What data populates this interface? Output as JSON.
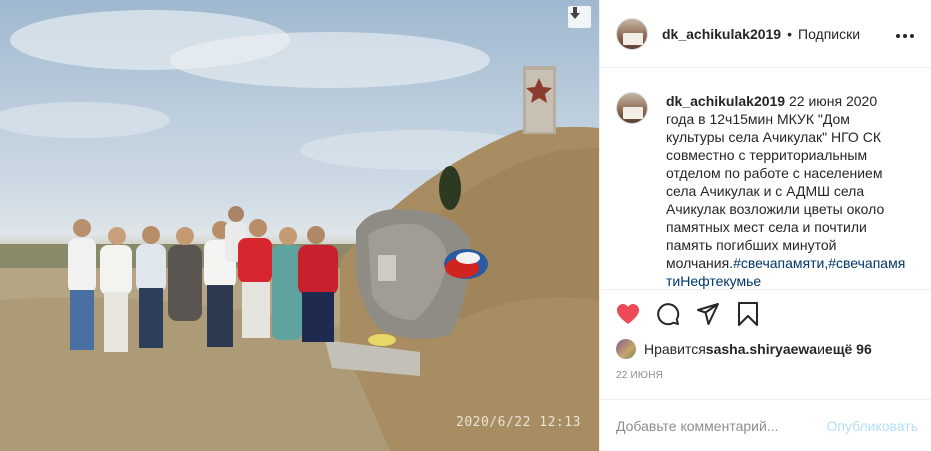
{
  "photo": {
    "timestamp": "2020/6/22  12:13",
    "download_icon": "arrow-down-icon"
  },
  "header": {
    "username": "dk_achikulak2019",
    "separator": "•",
    "follow_label": "Подписки",
    "more_icon": "more-horizontal-icon"
  },
  "caption": {
    "username": "dk_achikulak2019",
    "text": " 22 июня 2020 года в 12ч15мин МКУК \"Дом культуры села Ачикулак\" НГО СК совместно с территориальным отделом по работе с населением села Ачикулак и с АДМШ села Ачикулак возложили цветы около памятных мест села и почтили память погибших минутой молчания.",
    "hashtags": "#свечапамяти,#свечапамятиНефтекумье"
  },
  "actions": {
    "like_icon": "heart-filled-icon",
    "comment_icon": "comment-icon",
    "share_icon": "paper-plane-icon",
    "save_icon": "bookmark-icon",
    "like_color": "#ed4956"
  },
  "likes": {
    "prefix": "Нравится ",
    "user": "sasha.shiryaewa",
    "middle": " и ",
    "count": "ещё 96"
  },
  "date": "22 ИЮНЯ",
  "comment": {
    "placeholder": "Добавьте комментарий...",
    "publish_label": "Опубликовать"
  }
}
